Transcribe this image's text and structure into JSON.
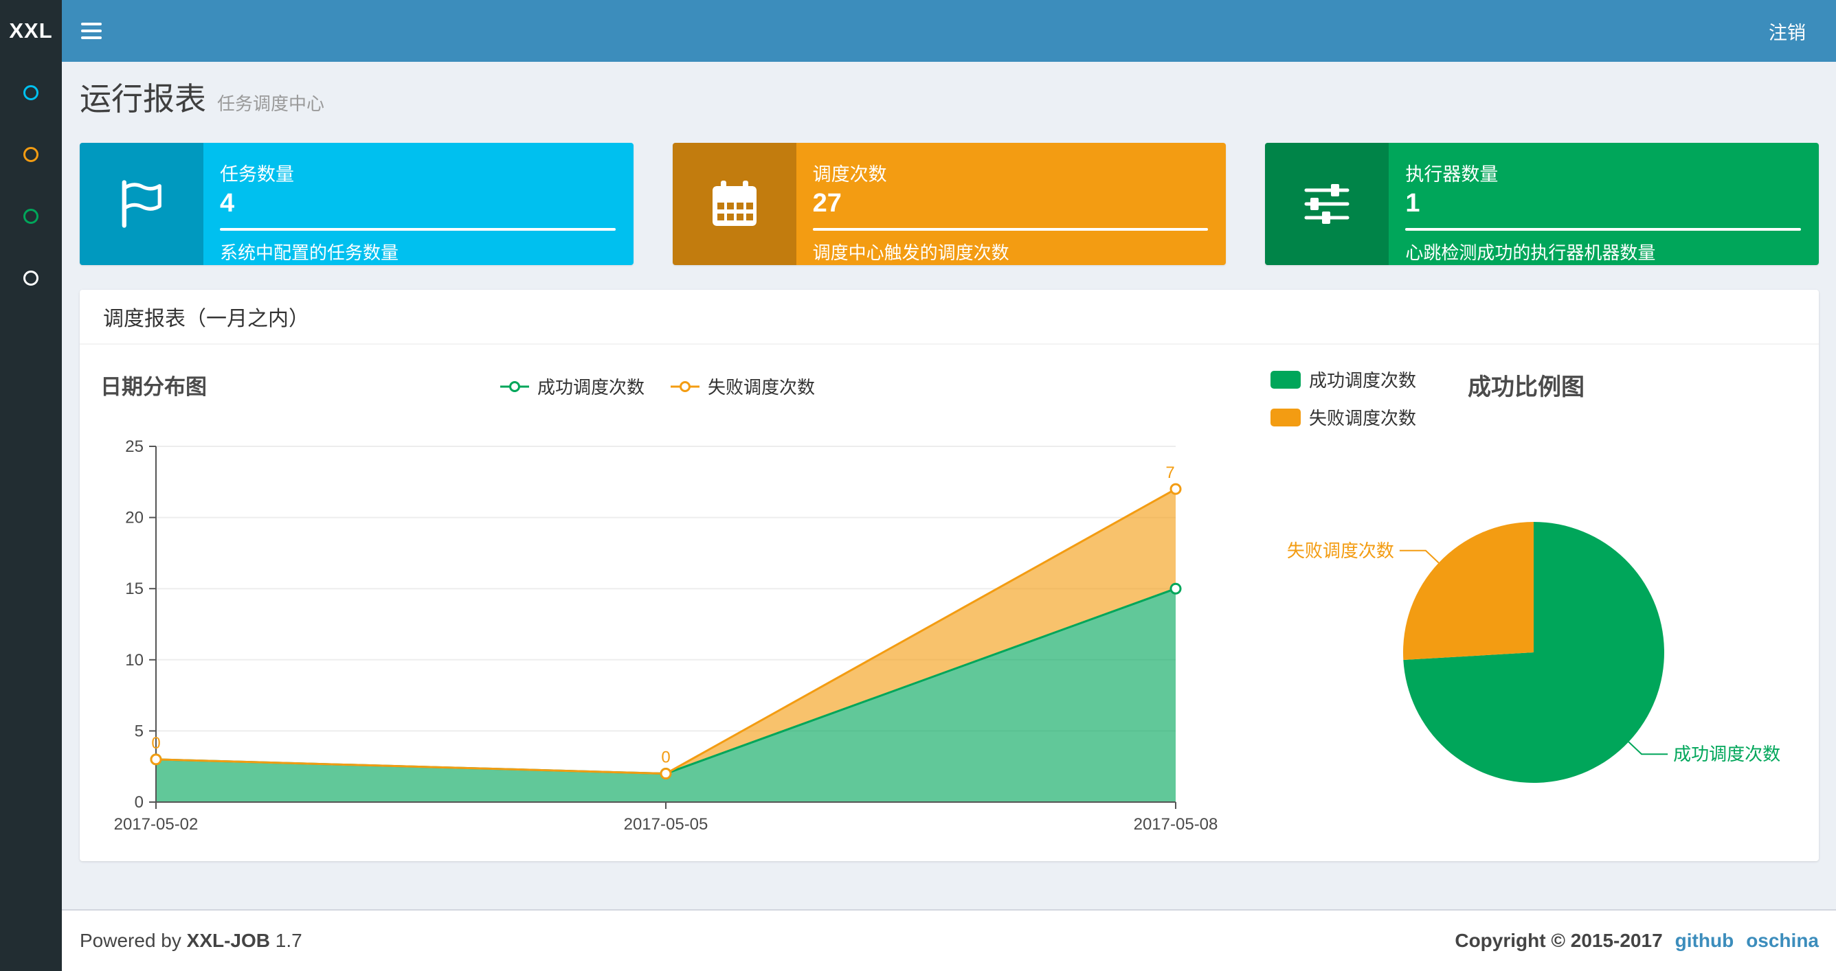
{
  "navbar": {
    "logo": "XXL",
    "logout_label": "注销"
  },
  "sidebar": {
    "items": [
      {
        "name": "menu-circle-1",
        "color": "#00c0ef"
      },
      {
        "name": "menu-circle-2",
        "color": "#f39c12"
      },
      {
        "name": "menu-circle-3",
        "color": "#00a65a"
      },
      {
        "name": "menu-circle-4",
        "color": "#ffffff"
      }
    ]
  },
  "header": {
    "title": "运行报表",
    "subtitle": "任务调度中心"
  },
  "info_boxes": [
    {
      "label": "任务数量",
      "number": "4",
      "desc": "系统中配置的任务数量",
      "color": "#00c0ef",
      "icon": "flag-icon"
    },
    {
      "label": "调度次数",
      "number": "27",
      "desc": "调度中心触发的调度次数",
      "color": "#f39c12",
      "icon": "calendar-icon"
    },
    {
      "label": "执行器数量",
      "number": "1",
      "desc": "心跳检测成功的执行器机器数量",
      "color": "#00a65a",
      "icon": "sliders-icon"
    }
  ],
  "panel": {
    "title": "调度报表（一月之内）"
  },
  "chart_data": [
    {
      "type": "area",
      "title": "日期分布图",
      "x": [
        "2017-05-02",
        "2017-05-05",
        "2017-05-08"
      ],
      "series": [
        {
          "name": "成功调度次数",
          "color": "#00a65a",
          "values": [
            3,
            2,
            15
          ],
          "stack": true
        },
        {
          "name": "失败调度次数",
          "color": "#f39c12",
          "values": [
            0,
            0,
            7
          ],
          "stack": true,
          "labels": [
            "0",
            "0",
            "7"
          ]
        }
      ],
      "ylim": [
        0,
        25
      ],
      "yticks": [
        0,
        5,
        10,
        15,
        20,
        25
      ],
      "legend_position": "top-center",
      "grid": true
    },
    {
      "type": "pie",
      "title": "成功比例图",
      "slices": [
        {
          "label": "成功调度次数",
          "value": 20,
          "color": "#00a65a"
        },
        {
          "label": "失败调度次数",
          "value": 7,
          "color": "#f39c12"
        }
      ],
      "legend_position": "top-left"
    }
  ],
  "footer": {
    "powered_prefix": "Powered by",
    "product": "XXL-JOB",
    "version": "1.7",
    "copyright": "Copyright © 2015-2017",
    "links": [
      "github",
      "oschina"
    ]
  },
  "colors": {
    "navbar": "#3c8dbc",
    "sidebar": "#222d32",
    "content_bg": "#ecf0f5",
    "aqua": "#00c0ef",
    "yellow": "#f39c12",
    "green": "#00a65a",
    "link": "#3c8dbc"
  }
}
